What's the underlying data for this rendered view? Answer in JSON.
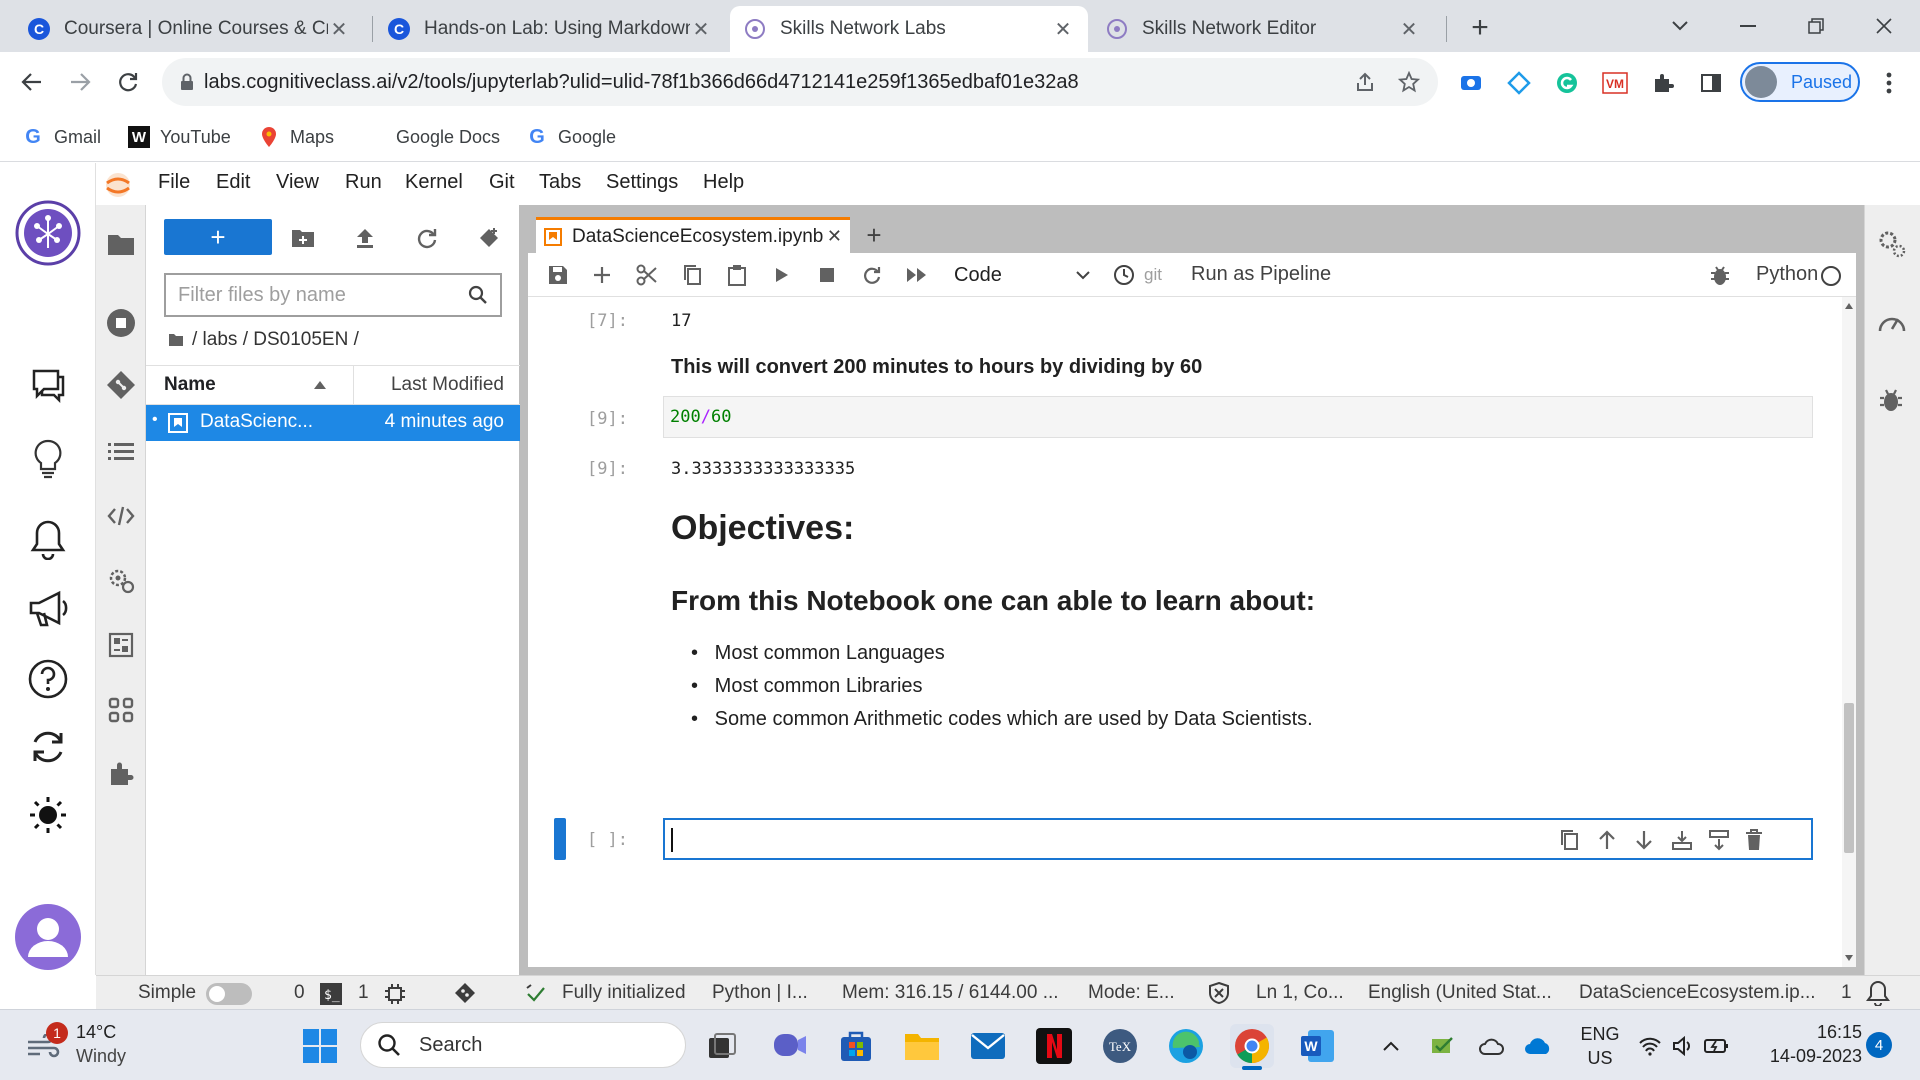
{
  "browser": {
    "tabs": [
      {
        "title": "Coursera | Online Courses & Credentials",
        "favicon": "coursera-icon"
      },
      {
        "title": "Hands-on Lab: Using Markdown",
        "favicon": "coursera-icon"
      },
      {
        "title": "Skills Network Labs",
        "favicon": "skills-network-icon",
        "active": true
      },
      {
        "title": "Skills Network Editor",
        "favicon": "skills-network-icon"
      }
    ],
    "url": "labs.cognitiveclass.ai/v2/tools/jupyterlab?ulid=ulid-78f1b366d66d4712141e259f1365edbaf01e32a8",
    "profile_label": "Paused",
    "bookmarks": [
      "Gmail",
      "YouTube",
      "Maps",
      "Google Docs",
      "Google"
    ]
  },
  "jupyter": {
    "menu": [
      "File",
      "Edit",
      "View",
      "Run",
      "Kernel",
      "Git",
      "Tabs",
      "Settings",
      "Help"
    ],
    "filebrowser": {
      "filter_placeholder": "Filter files by name",
      "breadcrumb": "/ labs / DS0105EN /",
      "col_name": "Name",
      "col_modified": "Last Modified",
      "files": [
        {
          "name": "DataScienc...",
          "modified": "4 minutes ago"
        }
      ]
    },
    "notebook": {
      "tab_title": "DataScienceEcosystem.ipynb",
      "cell_type": "Code",
      "git_label": "git",
      "pipeline_label": "Run as Pipeline",
      "kernel": "Python",
      "cells": {
        "out7_prompt": "[7]:",
        "out7_text": "17",
        "md1": "This will convert 200 minutes to hours by dividing by 60",
        "in9_prompt": "[9]:",
        "in9_num1": "200",
        "in9_op": "/",
        "in9_num2": "60",
        "out9_prompt": "[9]:",
        "out9_text": "3.3333333333333335",
        "heading1": "Objectives:",
        "heading2": "From this Notebook one can able to learn about:",
        "bullets": [
          "Most common Languages",
          "Most common Libraries",
          "Some common Arithmetic codes which are used by Data Scientists."
        ],
        "empty_prompt": "[ ]:"
      }
    },
    "status": {
      "simple": "Simple",
      "terminals": "0",
      "kernels": "1",
      "init": "Fully initialized",
      "kernel": "Python | I...",
      "mem": "Mem: 316.15 / 6144.00 ...",
      "mode": "Mode: E...",
      "position": "Ln 1, Co...",
      "language": "English (United Stat...",
      "file": "DataScienceEcosystem.ip...",
      "notifications": "1"
    }
  },
  "taskbar": {
    "weather_temp": "14°C",
    "weather_desc": "Windy",
    "weather_badge": "1",
    "search_label": "Search",
    "lang_top": "ENG",
    "lang_bottom": "US",
    "time": "16:15",
    "date": "14-09-2023",
    "notif_count": "4"
  },
  "colors": {
    "accent": "#1976d2",
    "chrome_blue": "#1a73e8",
    "selected_row": "#1e88e5",
    "active_tab_marker": "#f57c00",
    "code_number": "#008000"
  }
}
